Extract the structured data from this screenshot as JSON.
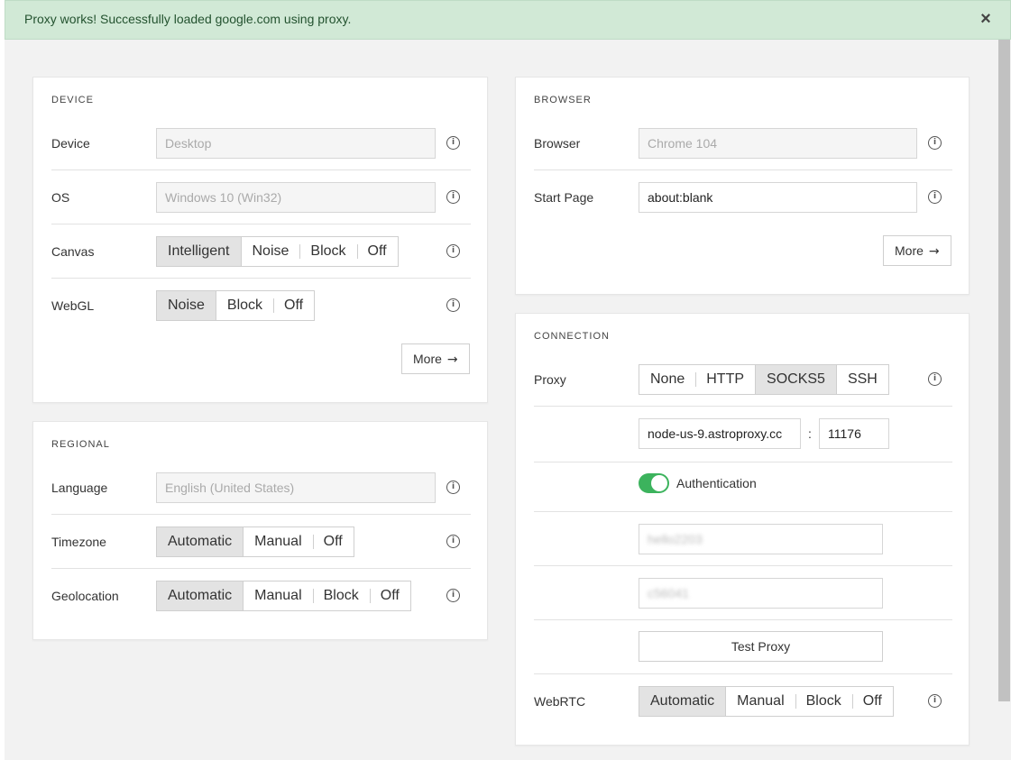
{
  "alert": {
    "message": "Proxy works! Successfully loaded google.com using proxy.",
    "close": "×"
  },
  "device": {
    "title": "DEVICE",
    "device_label": "Device",
    "device_value": "Desktop",
    "os_label": "OS",
    "os_value": "Windows 10 (Win32)",
    "canvas_label": "Canvas",
    "canvas_options": [
      "Intelligent",
      "Noise",
      "Block",
      "Off"
    ],
    "webgl_label": "WebGL",
    "webgl_options": [
      "Noise",
      "Block",
      "Off"
    ],
    "more": "More",
    "arrow": "→"
  },
  "regional": {
    "title": "REGIONAL",
    "language_label": "Language",
    "language_value": "English (United States)",
    "timezone_label": "Timezone",
    "timezone_options": [
      "Automatic",
      "Manual",
      "Off"
    ],
    "geolocation_label": "Geolocation",
    "geolocation_options": [
      "Automatic",
      "Manual",
      "Block",
      "Off"
    ]
  },
  "browser": {
    "title": "BROWSER",
    "browser_label": "Browser",
    "browser_value": "Chrome 104",
    "start_page_label": "Start Page",
    "start_page_value": "about:blank",
    "more": "More",
    "arrow": "→"
  },
  "connection": {
    "title": "CONNECTION",
    "proxy_label": "Proxy",
    "proxy_options": [
      "None",
      "HTTP",
      "SOCKS5",
      "SSH"
    ],
    "host_value": "node-us-9.astroproxy.cc",
    "colon": ":",
    "port_value": "11176",
    "auth_label": "Authentication",
    "username_value": "hello2203",
    "password_value": "c56041",
    "test_button": "Test Proxy",
    "webrtc_label": "WebRTC",
    "webrtc_options": [
      "Automatic",
      "Manual",
      "Block",
      "Off"
    ]
  },
  "info_glyph": "i",
  "colors": {
    "alert_bg": "#d1e9d6",
    "toggle_on": "#3cb35d",
    "active_segment": "#e3e3e3"
  }
}
